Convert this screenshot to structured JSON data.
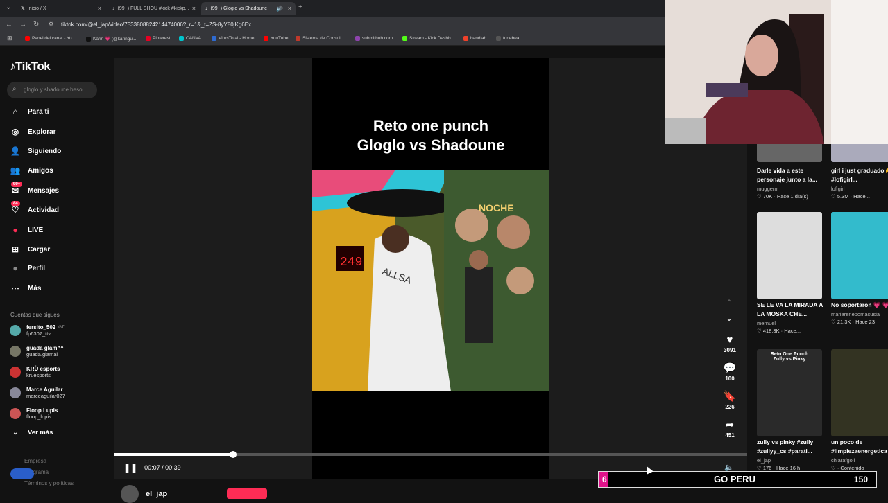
{
  "browser": {
    "tabs": [
      {
        "label": "Inicio / X",
        "icon": "x-logo-icon"
      },
      {
        "label": "(99+) FULL SHOU #kick #kickp...",
        "icon": "tiktok-icon"
      },
      {
        "label": "(99+) Gloglo vs Shadoune",
        "icon": "tiktok-icon"
      }
    ],
    "new_tab": "+",
    "url": "tiktok.com/@el_jap/video/7533808824214474006?_r=1&_t=ZS-8yY80jKg6Ex",
    "bookmarks": [
      "Panel del canal - Yo...",
      "Karin 💗 (@karingu...",
      "Pinterest",
      "CANVA",
      "VirusTotal - Home",
      "YouTube",
      "Sistema de Consult...",
      "submithub.com",
      "Stream - Kick Dashb...",
      "bandlab",
      "tunebeat"
    ],
    "bookmark_colors": [
      "#ff0000",
      "#111111",
      "#e60023",
      "#00c4cc",
      "#2f6bd1",
      "#ff0000",
      "#c0392b",
      "#8e44ad",
      "#53fc18",
      "#f0412a",
      "#555555"
    ]
  },
  "sidebar": {
    "logo": "TikTok",
    "search_placeholder": "gloglo y shadoune beso",
    "nav": [
      {
        "label": "Para ti",
        "icon": "home-icon"
      },
      {
        "label": "Explorar",
        "icon": "compass-icon"
      },
      {
        "label": "Siguiendo",
        "icon": "following-icon"
      },
      {
        "label": "Amigos",
        "icon": "friends-icon"
      },
      {
        "label": "Mensajes",
        "icon": "messages-icon",
        "badge": "99+"
      },
      {
        "label": "Actividad",
        "icon": "activity-icon",
        "badge": "84"
      },
      {
        "label": "LIVE",
        "icon": "live-icon"
      },
      {
        "label": "Cargar",
        "icon": "upload-icon"
      },
      {
        "label": "Perfil",
        "icon": "profile-icon"
      },
      {
        "label": "Más",
        "icon": "more-icon"
      }
    ],
    "following_title": "Cuentas que sigues",
    "accounts": [
      {
        "name": "fersito_502",
        "tag": "GT",
        "user": "fp6307_ttv"
      },
      {
        "name": "guada glam^^",
        "user": "guada.glamai"
      },
      {
        "name": "KRÜ esports",
        "user": "kruesports"
      },
      {
        "name": "Marce Aguilar",
        "user": "marceaguilar027"
      },
      {
        "name": "Floop Lupis",
        "user": "floop_lupis"
      }
    ],
    "see_more": "Ver más",
    "footer": [
      "Empresa",
      "Programa",
      "Términos y políticas"
    ]
  },
  "video": {
    "title_line1": "Reto one punch",
    "title_line2": "Gloglo vs Shadoune",
    "time": "00:07 / 00:39",
    "progress": 0.188,
    "likes": "3091",
    "comments": "100",
    "saves": "226",
    "shares": "451",
    "author": "el_jap",
    "score_display": "249"
  },
  "feed": [
    {
      "title": "Darle vida a este personaje junto a la...",
      "user": "muggerrr",
      "likes": "70K",
      "time": "Hace 1 día(s)"
    },
    {
      "title": "girl i just graduado 🫶 #lofigirl...",
      "user": "lofigirl",
      "likes": "5.3M",
      "time": "Hace..."
    },
    {
      "title": "SE LE VA LA MIRADA A LA MOSKA CHE...",
      "user": "mernuel",
      "likes": "418.3K",
      "time": "Hace..."
    },
    {
      "title": "No soportaron 💗 💗",
      "user": "mariarenepomacusia",
      "likes": "21.3K",
      "time": "Hace 23"
    },
    {
      "title": "zully vs pinky #zully #zullyy_cs #parati...",
      "user": "el_jap",
      "likes": "176",
      "time": "Hace 16 h",
      "overlay": "Reto One Punch Zully vs Pinky"
    },
    {
      "title": "un poco de #limpiezaenergetica",
      "user": "chiarafgoli",
      "likes": "",
      "time": "Contenido"
    }
  ],
  "goal": {
    "current": "6",
    "label": "GO PERU",
    "target": "150"
  },
  "colors": {
    "accent": "#fe2c55",
    "goal_pink": "#e0128a"
  }
}
